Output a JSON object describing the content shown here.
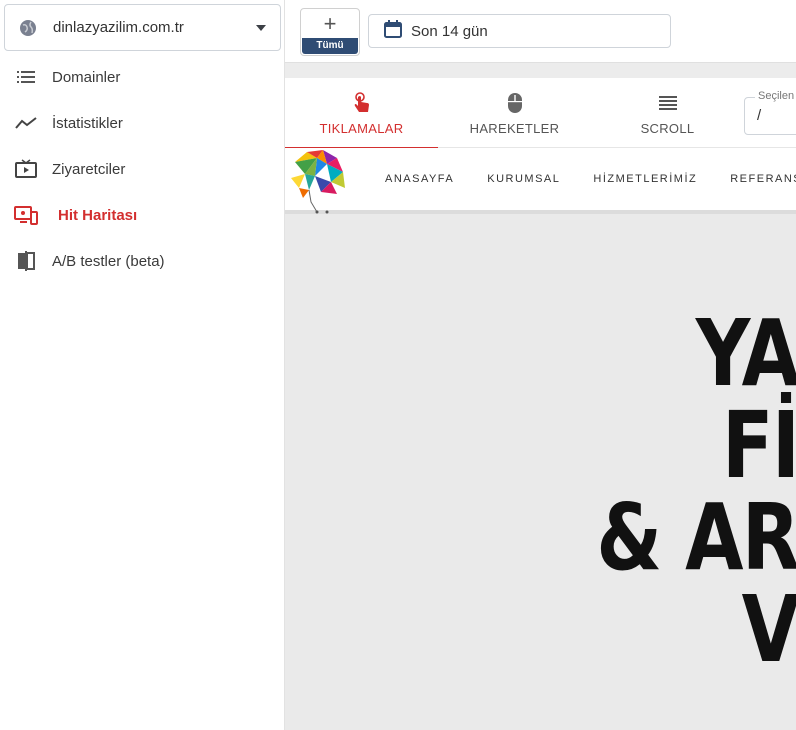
{
  "sidebar": {
    "site_select": {
      "value": "dinlazyazilim.com.tr"
    },
    "items": [
      {
        "label": "Domainler",
        "icon": "list-icon",
        "active": false
      },
      {
        "label": "İstatistikler",
        "icon": "trend-line-icon",
        "active": false
      },
      {
        "label": "Ziyaretciler",
        "icon": "tv-play-icon",
        "active": false
      },
      {
        "label": "Hit Haritası",
        "icon": "devices-icon",
        "active": true
      },
      {
        "label": "A/B testler (beta)",
        "icon": "compare-icon",
        "active": false
      }
    ]
  },
  "toolbar": {
    "add_button": {
      "plus": "+",
      "badge": "Tümü"
    },
    "date_range": "Son 14 gün"
  },
  "tabs": [
    {
      "label": "TIKLAMALAR",
      "icon": "touch-icon",
      "active": true
    },
    {
      "label": "HAREKETLER",
      "icon": "mouse-icon",
      "active": false
    },
    {
      "label": "SCROLL",
      "icon": "scroll-icon",
      "active": false
    }
  ],
  "page_field": {
    "legend": "Seçilen",
    "value": "/"
  },
  "preview": {
    "menu": [
      "ANASAYFA",
      "KURUMSAL",
      "HİZMETLERİMİZ",
      "REFERANSLAR"
    ],
    "hero_lines": [
      "YA",
      "Fİ",
      "& AR",
      "V"
    ]
  },
  "colors": {
    "accent": "#d32f2f",
    "badge": "#2f4c74",
    "preview_bg": "#eaeaea"
  }
}
